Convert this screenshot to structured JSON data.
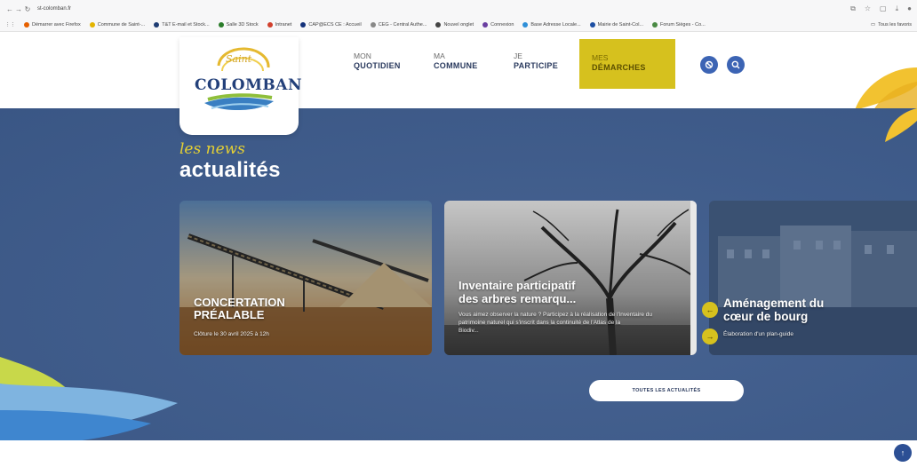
{
  "browser": {
    "url": "st-colomban.fr",
    "bookmarks": [
      {
        "label": "Démarrer avec Firefox",
        "color": "#e66000"
      },
      {
        "label": "Commune de Saint-...",
        "color": "#e3b400"
      },
      {
        "label": "T&T E-mail et Stock...",
        "color": "#1f3d73"
      },
      {
        "label": "Salle 3D Stock",
        "color": "#2a7c2a"
      },
      {
        "label": "Intranet",
        "color": "#d1402d"
      },
      {
        "label": "CAP@ECS CE : Accueil",
        "color": "#13317a"
      },
      {
        "label": "CEG - Central Authe...",
        "color": "#888888"
      },
      {
        "label": "Nouvel onglet",
        "color": "#444444"
      },
      {
        "label": "Connexion",
        "color": "#6a3fa1"
      },
      {
        "label": "Base Adresse Locale...",
        "color": "#2f8fd8"
      },
      {
        "label": "Mairie de Saint-Col...",
        "color": "#1d4fa3"
      },
      {
        "label": "Forum Sièges - Co...",
        "color": "#4a8a44"
      }
    ],
    "bookmarks_right": "Tous les favoris"
  },
  "logo": {
    "script": "Saint",
    "name": "COLOMBAN"
  },
  "nav": [
    {
      "small": "MON",
      "big": "QUOTIDIEN"
    },
    {
      "small": "MA",
      "big": "COMMUNE"
    },
    {
      "small": "JE",
      "big": "PARTICIPE"
    },
    {
      "small": "MES",
      "big": "DÉMARCHES"
    }
  ],
  "hero": {
    "tagline": "les news",
    "title": "actualités",
    "cards": [
      {
        "title_lines": [
          "CONCERTATION",
          "PRÉALABLE"
        ],
        "subtitle": "Clôture le 30 avril 2025 à 12h"
      },
      {
        "title_lines": [
          "Inventaire participatif",
          "des arbres remarqu..."
        ],
        "subtitle_lines": [
          "Vous aimez observer la nature ? Participez à la réalisation de l'inventaire du",
          "patrimoine naturel qui s'inscrit dans la continuité de l'Atlas de la",
          "Biodiv..."
        ]
      },
      {
        "title_lines": [
          "Aménagement du",
          "cœur de bourg"
        ],
        "subtitle": "Élaboration d'un plan-guide"
      }
    ],
    "all_news_label": "TOUTES LES ACTUALITÉS"
  },
  "colors": {
    "hero_bg": "#3d5b8c",
    "accent_yellow": "#d6c11e",
    "button_blue": "#3c64b4"
  }
}
